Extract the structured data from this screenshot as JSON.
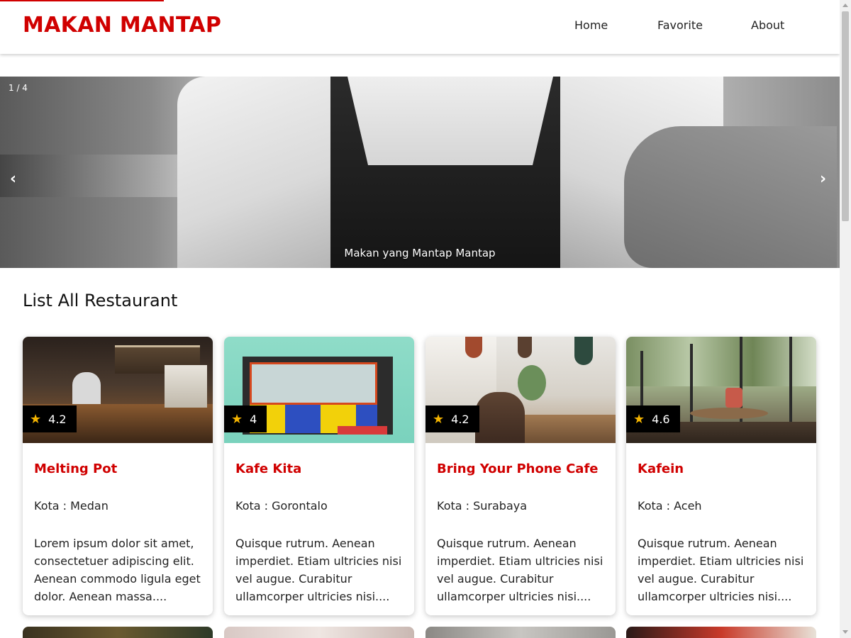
{
  "header": {
    "brand": "MAKAN MANTAP",
    "nav": [
      {
        "label": "Home"
      },
      {
        "label": "Favorite"
      },
      {
        "label": "About"
      }
    ]
  },
  "hero": {
    "counter": "1 / 4",
    "prev_icon": "‹",
    "next_icon": "›",
    "caption": "Makan yang Mantap Mantap"
  },
  "section": {
    "title": "List All Restaurant"
  },
  "restaurants": [
    {
      "name": "Melting Pot",
      "rating": "4.2",
      "city": "Kota : Medan",
      "description": "Lorem ipsum dolor sit amet, consectetuer adipiscing elit. Aenean commodo ligula eget dolor. Aenean massa...."
    },
    {
      "name": "Kafe Kita",
      "rating": "4",
      "city": "Kota : Gorontalo",
      "description": "Quisque rutrum. Aenean imperdiet. Etiam ultricies nisi vel augue. Curabitur ullamcorper ultricies nisi...."
    },
    {
      "name": "Bring Your Phone Cafe",
      "rating": "4.2",
      "city": "Kota : Surabaya",
      "description": "Quisque rutrum. Aenean imperdiet. Etiam ultricies nisi vel augue. Curabitur ullamcorper ultricies nisi...."
    },
    {
      "name": "Kafein",
      "rating": "4.6",
      "city": "Kota : Aceh",
      "description": "Quisque rutrum. Aenean imperdiet. Etiam ultricies nisi vel augue. Curabitur ullamcorper ultricies nisi...."
    }
  ],
  "star_icon": "★",
  "colors": {
    "accent": "#d00000",
    "star": "#f4b400"
  }
}
